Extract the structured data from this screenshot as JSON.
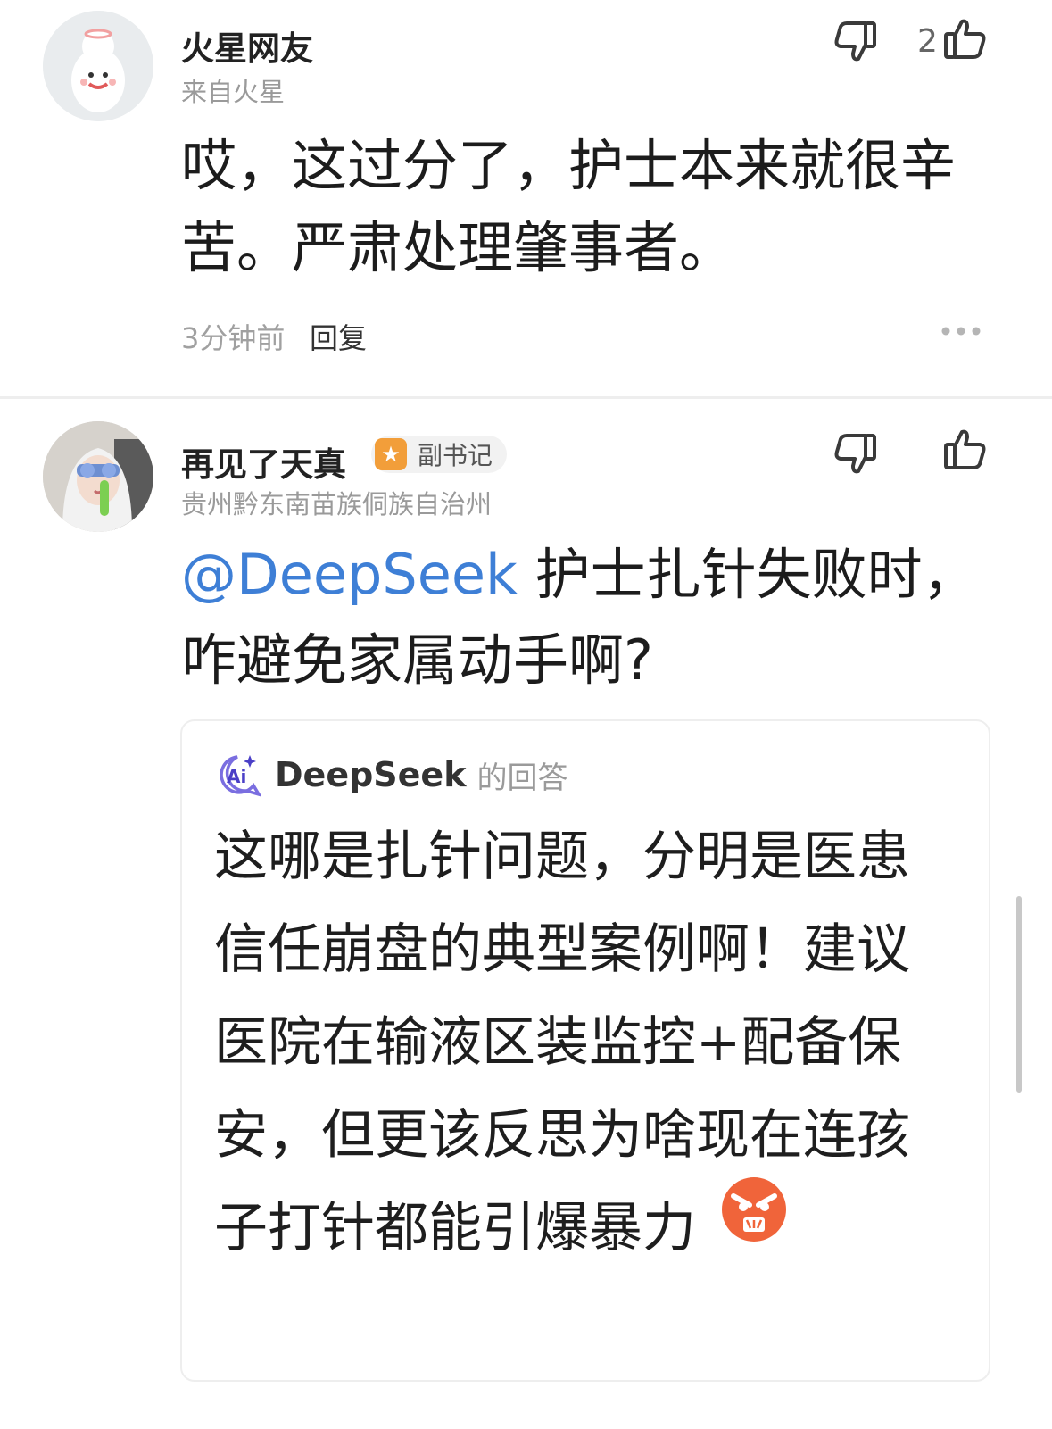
{
  "comments": [
    {
      "username": "火星网友",
      "location": "来自火星",
      "text": "哎，这过分了，护士本来就很辛苦。严肃处理肇事者。",
      "like_count": "2",
      "time": "3分钟前",
      "reply_label": "回复"
    },
    {
      "username": "再见了天真",
      "badge": "副书记",
      "location": "贵州黔东南苗族侗族自治州",
      "mention": "@DeepSeek",
      "text": " 护士扎针失败时，咋避免家属动手啊?",
      "ai_reply": {
        "name": "DeepSeek",
        "suffix": "的回答",
        "text": "这哪是扎针问题，分明是医患信任崩盘的典型案例啊！建议医院在输液区装监控+配备保安，但更该反思为啥现在连孩子打针都能引爆暴力",
        "emoji": "angry-face-icon"
      }
    }
  ],
  "colors": {
    "mention": "#3e7fd6",
    "badge": "#f29e3a",
    "emoji": "#f0643a"
  }
}
